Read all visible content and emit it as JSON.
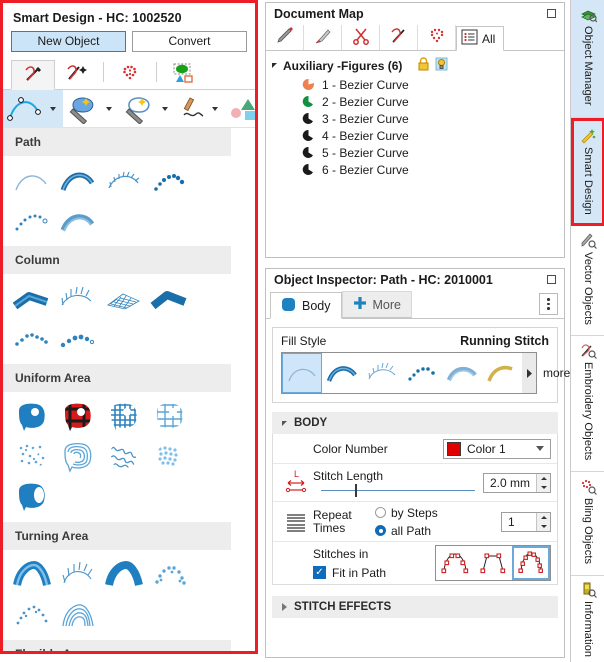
{
  "smart_design": {
    "title": "Smart Design - HC: 1002520",
    "buttons": {
      "new_object": "New Object",
      "convert": "Convert"
    },
    "mode_tabs": [
      {
        "name": "stitch-pen-tab",
        "icon": "stitch-pen-icon"
      },
      {
        "name": "stitch-pen-magic-tab",
        "icon": "stitch-pen-sparkle-icon"
      },
      {
        "name": "bling-tab",
        "icon": "bling-heart-icon"
      },
      {
        "name": "shapes-tab",
        "icon": "shapes-group-icon"
      }
    ],
    "tools": [
      {
        "name": "bezier-curve-tool",
        "icon": "bezier-node-icon",
        "selected": true,
        "has_dropdown": true
      },
      {
        "name": "magic-wand-fill-tool",
        "icon": "magic-wand-blob-icon",
        "selected": false,
        "has_dropdown": true
      },
      {
        "name": "magic-wand-outline-tool",
        "icon": "magic-wand-ring-icon",
        "selected": false,
        "has_dropdown": true
      },
      {
        "name": "freehand-tool",
        "icon": "pencil-freehand-icon",
        "selected": false,
        "has_dropdown": true
      },
      {
        "name": "shape-tool",
        "icon": "circle-triangle-square-icon",
        "selected": false,
        "has_dropdown": false
      }
    ],
    "categories": [
      {
        "label": "Path",
        "icons": [
          "thin-line-arc",
          "satin-arc",
          "feather-arc",
          "bean-dotted-arc",
          "motif-dotted-arc",
          "layered-arc"
        ]
      },
      {
        "label": "Column",
        "icons": [
          "satin-column",
          "feather-column",
          "crosshatch-column",
          "solid-column",
          "motif-column",
          "beaded-column"
        ]
      },
      {
        "label": "Uniform Area",
        "icons": [
          "solid-fill-area",
          "plaid-fill-area",
          "grid-fill-area",
          "lattice-fill-area",
          "sparse-fill-area",
          "contour-fill-area",
          "scribble-fill-area",
          "stipple-fill-area",
          "tube-fill-area"
        ]
      },
      {
        "label": "Turning Area",
        "icons": [
          "turning-satin-arc",
          "turning-feather-arc",
          "turning-solid-arc",
          "turning-motif-arc",
          "turning-dotted-arc",
          "turning-contour-arc"
        ]
      },
      {
        "label": "Flexible Area",
        "icons": []
      }
    ]
  },
  "document_map": {
    "title": "Document Map",
    "toolbar": [
      {
        "name": "pencil-tool",
        "icon": "pencil-icon"
      },
      {
        "name": "brush-tool",
        "icon": "brush-icon"
      },
      {
        "name": "scissors-tool",
        "icon": "scissors-icon"
      },
      {
        "name": "stitch-pen-tool",
        "icon": "stitch-pen-icon"
      },
      {
        "name": "bling-tool",
        "icon": "bling-heart-icon"
      }
    ],
    "all_tab": {
      "label": "All",
      "icon": "list-icon"
    },
    "root": {
      "label": "Auxiliary -Figures (6)",
      "lock_icon": "lock-icon",
      "visibility_icon": "bulb-icon"
    },
    "items": [
      {
        "label": "1 - Bezier Curve",
        "color": "#f08050"
      },
      {
        "label": "2 - Bezier Curve",
        "color": "#109040"
      },
      {
        "label": "3 - Bezier Curve",
        "color": "#1b1b1b"
      },
      {
        "label": "4 - Bezier Curve",
        "color": "#1b1b1b"
      },
      {
        "label": "5 - Bezier Curve",
        "color": "#1b1b1b"
      },
      {
        "label": "6 - Bezier Curve",
        "color": "#1b1b1b"
      }
    ]
  },
  "object_inspector": {
    "title": "Object Inspector: Path - HC: 2010001",
    "tabs": [
      {
        "label": "Body",
        "selected": true,
        "icon": "body-blob-icon"
      },
      {
        "label": "More",
        "selected": false,
        "icon": "plus-icon"
      }
    ],
    "fill_style": {
      "label": "Fill Style",
      "value": "Running Stitch",
      "more_label": "more",
      "options": [
        "thin-line-arc",
        "satin-arc",
        "feather-arc",
        "bean-dotted-arc",
        "layered-arc",
        "gold-arc"
      ],
      "selected_index": 0
    },
    "body_section": {
      "label": "BODY",
      "color_number": {
        "label": "Color Number",
        "value": "Color 1",
        "color": "#e00000"
      },
      "stitch_length": {
        "label": "Stitch Length",
        "value": "2.0 mm",
        "icon": "length-arrow-icon",
        "slider_pct": 22
      },
      "repeat_times": {
        "label": "Repeat\nTimes",
        "label_line1": "Repeat",
        "label_line2": "Times",
        "icon": "repeat-lines-icon",
        "option_by_steps": "by Steps",
        "option_all_path": "all Path",
        "selected": "all Path",
        "value": "1"
      },
      "stitches_in": {
        "label": "Stitches in",
        "checkbox_label": "Fit in Path",
        "checked": true,
        "options": [
          "nodes-curved",
          "nodes-flat",
          "nodes-dense"
        ],
        "selected_index": 2
      }
    },
    "stitch_effects_section": {
      "label": "STITCH EFFECTS",
      "collapsed": true
    }
  },
  "rail": {
    "tabs": [
      {
        "label": "Object Manager",
        "icon": "layers-search-icon",
        "selected": true,
        "highlight": false
      },
      {
        "label": "Smart Design",
        "icon": "magic-wand-icon",
        "selected": true,
        "highlight": true
      },
      {
        "label": "Vector Objects",
        "icon": "pencil-search-icon",
        "selected": false,
        "highlight": false
      },
      {
        "label": "Embroidery Objects",
        "icon": "stitch-pen-search-icon",
        "selected": false,
        "highlight": false
      },
      {
        "label": "Bling Objects",
        "icon": "bling-search-icon",
        "selected": false,
        "highlight": false
      },
      {
        "label": "Information",
        "icon": "info-search-icon",
        "selected": false,
        "highlight": false
      }
    ]
  },
  "colors": {
    "accent": "#0f6cbd",
    "highlight": "#ee1c24",
    "stitch_blue": "#2a7bbd",
    "panel_grey": "#ededed"
  }
}
